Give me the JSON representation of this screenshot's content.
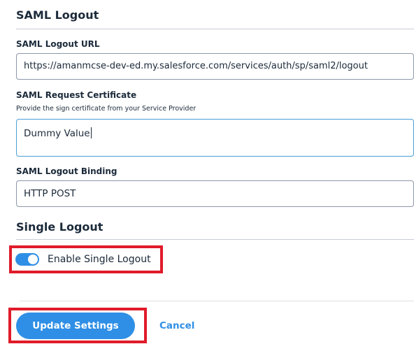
{
  "saml_logout": {
    "section_title": "SAML Logout",
    "logout_url": {
      "label": "SAML Logout URL",
      "value": "https://amanmcse-dev-ed.my.salesforce.com/services/auth/sp/saml2/logout"
    },
    "request_certificate": {
      "label": "SAML Request Certificate",
      "helper": "Provide the sign certificate from your Service Provider",
      "value": "Dummy Value"
    },
    "logout_binding": {
      "label": "SAML Logout Binding",
      "value": "HTTP POST"
    }
  },
  "single_logout": {
    "section_title": "Single Logout",
    "toggle_label": "Enable Single Logout",
    "enabled": true
  },
  "actions": {
    "update_label": "Update Settings",
    "cancel_label": "Cancel"
  },
  "colors": {
    "accent": "#2f8fe6",
    "highlight": "#e01b2a",
    "text": "#1b2a3a"
  }
}
